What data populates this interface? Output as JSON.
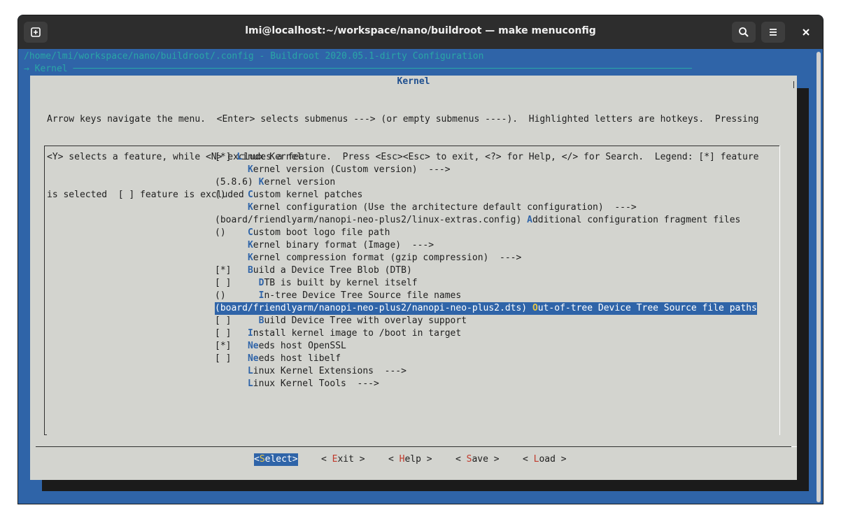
{
  "window": {
    "title": "lmi@localhost:~/workspace/nano/buildroot — make menuconfig"
  },
  "terminal": {
    "path_line": "/home/lmi/workspace/nano/buildroot/.config - Buildroot 2020.05.1-dirty Configuration",
    "breadcrumb_line": "→ Kernel ─────────────────────────────────────────────────────────────────────────────────────────────────────────────────",
    "dialog_title": "Kernel",
    "help_lines": [
      "Arrow keys navigate the menu.  <Enter> selects submenus ---> (or empty submenus ----).  Highlighted letters are hotkeys.  Pressing",
      "<Y> selects a feature, while <N> excludes a feature.  Press <Esc><Esc> to exit, <?> for Help, </> for Search.  Legend: [*] feature",
      "is selected  [ ] feature is excluded"
    ],
    "menu_items": [
      {
        "pre": "[*] ",
        "hk": "L",
        "rest": "inux Kernel",
        "selected": false
      },
      {
        "pre": "      ",
        "hk": "K",
        "rest": "ernel version (Custom version)  --->",
        "selected": false
      },
      {
        "pre": "(5.8.6) ",
        "hk": "K",
        "rest": "ernel version",
        "selected": false
      },
      {
        "pre": "()    ",
        "hk": "C",
        "rest": "ustom kernel patches",
        "selected": false
      },
      {
        "pre": "      ",
        "hk": "K",
        "rest": "ernel configuration (Use the architecture default configuration)  --->",
        "selected": false
      },
      {
        "pre": "(board/friendlyarm/nanopi-neo-plus2/linux-extras.config) ",
        "hk": "A",
        "rest": "dditional configuration fragment files",
        "selected": false
      },
      {
        "pre": "()    ",
        "hk": "C",
        "rest": "ustom boot logo file path",
        "selected": false
      },
      {
        "pre": "      ",
        "hk": "K",
        "rest": "ernel binary format (Image)  --->",
        "selected": false
      },
      {
        "pre": "      ",
        "hk": "K",
        "rest": "ernel compression format (gzip compression)  --->",
        "selected": false
      },
      {
        "pre": "[*]   ",
        "hk": "B",
        "rest": "uild a Device Tree Blob (DTB)",
        "selected": false
      },
      {
        "pre": "[ ]     ",
        "hk": "D",
        "rest": "TB is built by kernel itself",
        "selected": false
      },
      {
        "pre": "()      ",
        "hk": "I",
        "rest": "n-tree Device Tree Source file names",
        "selected": false
      },
      {
        "pre": "(board/friendlyarm/nanopi-neo-plus2/nanopi-neo-plus2.dts) ",
        "hk": "O",
        "rest": "ut-of-tree Device Tree Source file paths",
        "selected": true
      },
      {
        "pre": "[ ]     ",
        "hk": "B",
        "rest": "uild Device Tree with overlay support",
        "selected": false
      },
      {
        "pre": "[ ]   ",
        "hk": "I",
        "rest": "nstall kernel image to /boot in target",
        "selected": false
      },
      {
        "pre": "[*]   ",
        "hk": "Ne",
        "rest": "eds host OpenSSL",
        "selected": false
      },
      {
        "pre": "[ ]   ",
        "hk": "Ne",
        "rest": "eds host libelf",
        "selected": false
      },
      {
        "pre": "      ",
        "hk": "L",
        "rest": "inux Kernel Extensions  --->",
        "selected": false
      },
      {
        "pre": "      ",
        "hk": "L",
        "rest": "inux Kernel Tools  --->",
        "selected": false
      }
    ],
    "buttons": [
      {
        "pre": "<",
        "hk": "S",
        "rest": "elect>",
        "active": true
      },
      {
        "pre": "< ",
        "hk": "E",
        "rest": "xit >",
        "active": false
      },
      {
        "pre": "< ",
        "hk": "H",
        "rest": "elp >",
        "active": false
      },
      {
        "pre": "< ",
        "hk": "S",
        "rest": "ave >",
        "active": false
      },
      {
        "pre": "< ",
        "hk": "L",
        "rest": "oad >",
        "active": false
      }
    ]
  }
}
